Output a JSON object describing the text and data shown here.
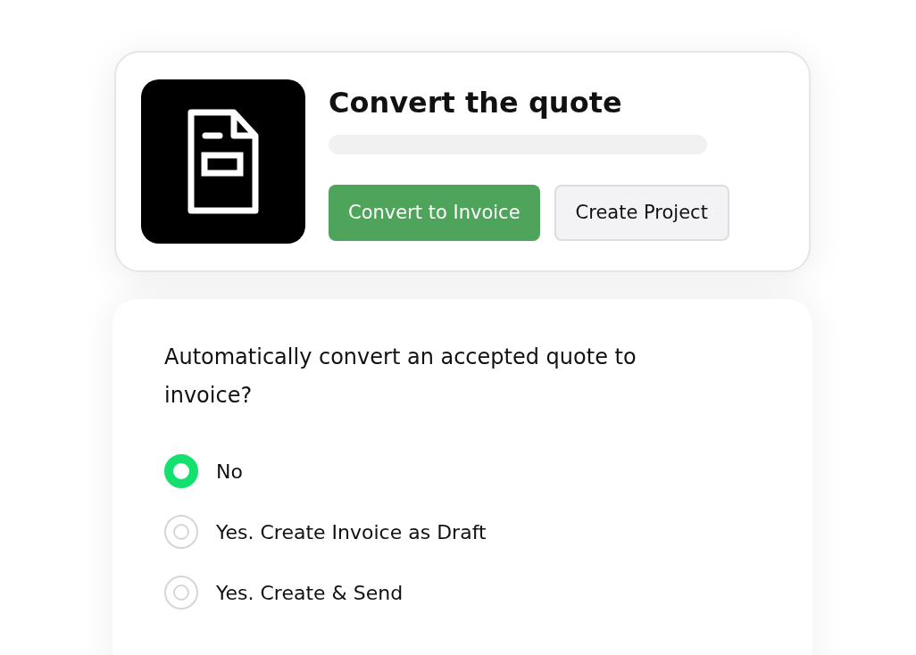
{
  "header_card": {
    "title": "Convert the quote",
    "buttons": [
      {
        "label": "Convert to Invoice",
        "kind": "primary"
      },
      {
        "label": "Create Project",
        "kind": "secondary"
      }
    ]
  },
  "settings_card": {
    "question": "Automatically convert an accepted quote to invoice?",
    "options": [
      {
        "label": "No",
        "selected": true
      },
      {
        "label": "Yes. Create Invoice as Draft",
        "selected": false
      },
      {
        "label": "Yes. Create & Send",
        "selected": false
      }
    ]
  }
}
